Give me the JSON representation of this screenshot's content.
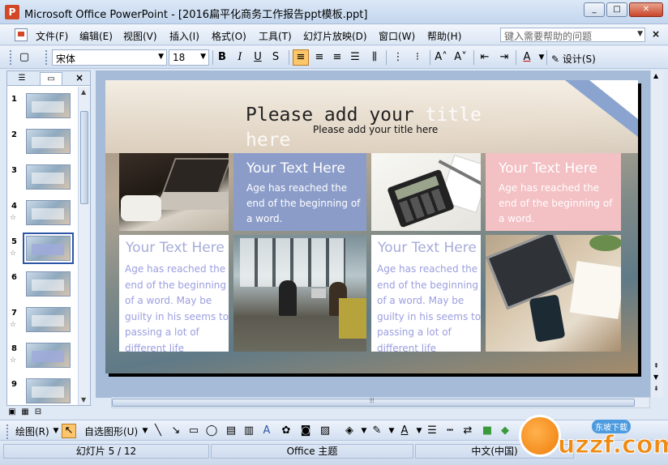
{
  "window": {
    "title": "Microsoft Office PowerPoint - [2016扁平化商务工作报告ppt模板.ppt]",
    "min_label": "▭",
    "max_label": "▢",
    "close_label": "✕"
  },
  "menu": {
    "items": [
      "文件(F)",
      "编辑(E)",
      "视图(V)",
      "插入(I)",
      "格式(O)",
      "工具(T)",
      "幻灯片放映(D)",
      "窗口(W)",
      "帮助(H)"
    ],
    "help_placeholder": "键入需要帮助的问题",
    "close_label": "×"
  },
  "toolbar": {
    "font_name": "宋体",
    "font_size": "18",
    "bold": "B",
    "italic": "I",
    "underline": "U",
    "shadow": "S",
    "design_label": "设计(S)",
    "font_color": "A"
  },
  "slides_panel": {
    "close_label": "×",
    "slides": [
      {
        "num": "1",
        "star": ""
      },
      {
        "num": "2",
        "star": ""
      },
      {
        "num": "3",
        "star": ""
      },
      {
        "num": "4",
        "star": "☆"
      },
      {
        "num": "5",
        "star": "☆"
      },
      {
        "num": "6",
        "star": ""
      },
      {
        "num": "7",
        "star": "☆"
      },
      {
        "num": "8",
        "star": "☆"
      },
      {
        "num": "9",
        "star": ""
      }
    ],
    "selected_index": 5
  },
  "slide": {
    "title_dark": "Please add your",
    "title_ghost_1": "title",
    "title_ghost_2": "here",
    "subtitle": "Please add your title here",
    "cards": [
      {
        "title": "Your Text Here",
        "body": "Age has reached the end of the beginning of a word."
      },
      {
        "title": "Your Text Here",
        "body": "Age has reached the end of the beginning of a word."
      },
      {
        "title": "Your Text Here",
        "body": "Age has reached the end of the beginning of a word. May be guilty in his seems to passing a lot of different life"
      },
      {
        "title": "Your Text Here",
        "body": "Age has reached the end of the beginning of a word. May be guilty in his seems to passing a lot of different life"
      }
    ]
  },
  "drawbar": {
    "draw_label": "绘图(R)",
    "autoshape_label": "自选图形(U)"
  },
  "status": {
    "slide_info": "幻灯片 5 / 12",
    "theme": "Office 主题",
    "language": "中文(中国)"
  },
  "watermark": {
    "site": "uzzf.com",
    "tag": "东坡下载"
  },
  "colors": {
    "card_blue": "#8b9cc9",
    "card_pink": "#f3c0c4",
    "card_white_text": "#9a9ee0",
    "accent": "#fdc66b"
  }
}
